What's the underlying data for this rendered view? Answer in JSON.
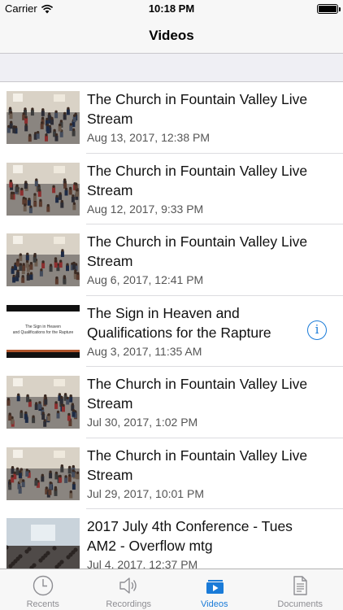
{
  "status_bar": {
    "carrier": "Carrier",
    "time": "10:18 PM"
  },
  "nav": {
    "title": "Videos"
  },
  "videos": [
    {
      "title": "The Church in Fountain Valley Live Stream",
      "date": "Aug 13, 2017, 12:38 PM",
      "thumbnail": "meeting-hall"
    },
    {
      "title": "The Church in Fountain Valley Live Stream",
      "date": "Aug 12, 2017, 9:33 PM",
      "thumbnail": "meeting-hall"
    },
    {
      "title": "The Church in Fountain Valley Live Stream",
      "date": "Aug 6, 2017, 12:41 PM",
      "thumbnail": "meeting-hall"
    },
    {
      "title": "The Sign in Heaven and Qualifications for the Rapture",
      "date": "Aug 3, 2017, 11:35 AM",
      "thumbnail": "title-slide",
      "thumb_text": "The Sign in Heaven and Qualifications for the Rapture",
      "has_info": true
    },
    {
      "title": "The Church in Fountain Valley Live Stream",
      "date": "Jul 30, 2017, 1:02 PM",
      "thumbnail": "meeting-hall"
    },
    {
      "title": "The Church in Fountain Valley Live Stream",
      "date": "Jul 29, 2017, 10:01 PM",
      "thumbnail": "meeting-hall"
    },
    {
      "title": "2017 July 4th Conference - Tues AM2 - Overflow mtg",
      "date": "Jul 4, 2017, 12:37 PM",
      "thumbnail": "conference-room"
    }
  ],
  "tabs": [
    {
      "label": "Recents",
      "icon": "clock-icon",
      "active": false
    },
    {
      "label": "Recordings",
      "icon": "speaker-icon",
      "active": false
    },
    {
      "label": "Videos",
      "icon": "video-icon",
      "active": true
    },
    {
      "label": "Documents",
      "icon": "document-icon",
      "active": false
    }
  ],
  "colors": {
    "accent": "#1a7bd8",
    "inactive": "#8e8e93",
    "bar_bg": "#f7f7f7",
    "section_bg": "#efeff4"
  }
}
